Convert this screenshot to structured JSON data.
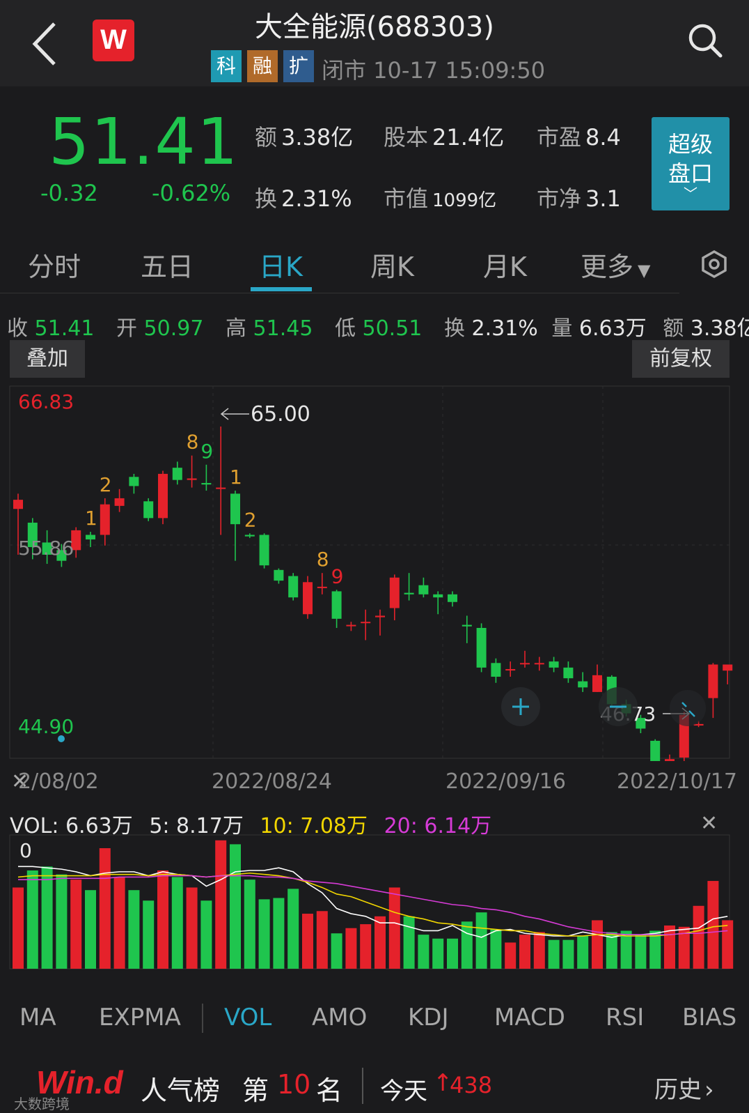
{
  "header": {
    "title": "大全能源(688303)",
    "logo_letter": "W",
    "tags": [
      "科",
      "融",
      "扩"
    ],
    "status": "闭市 10-17 15:09:50"
  },
  "quote": {
    "price": "51.41",
    "change": "-0.32",
    "change_pct": "-0.62%",
    "stats": [
      {
        "label": "额",
        "value": "3.38亿"
      },
      {
        "label": "股本",
        "value": "21.4亿"
      },
      {
        "label": "市盈",
        "value": "8.4"
      },
      {
        "label": "换",
        "value": "2.31%"
      },
      {
        "label": "市值",
        "value": "1099亿"
      },
      {
        "label": "市净",
        "value": "3.1"
      }
    ],
    "super_button": [
      "超级",
      "盘口"
    ]
  },
  "tabs": [
    "分时",
    "五日",
    "日K",
    "周K",
    "月K",
    "更多"
  ],
  "active_tab": "日K",
  "ohlc": {
    "close_label": "收",
    "close": "51.41",
    "open_label": "开",
    "open": "50.97",
    "high_label": "高",
    "high": "51.45",
    "low_label": "低",
    "low": "50.51",
    "turnover_label": "换",
    "turnover": "2.31%",
    "volume_label": "量",
    "volume": "6.63万",
    "amount_label": "额",
    "amount": "3.38亿"
  },
  "buttons": {
    "overlay": "叠加",
    "adjust": "前复权"
  },
  "kline": {
    "axis_top": "66.83",
    "axis_mid": "55.86",
    "axis_bottom": "44.90",
    "max_marker": "65.00",
    "min_marker": "46.73",
    "dates": [
      "2/08/02",
      "2022/08/24",
      "2022/09/16",
      "2022/10/17"
    ]
  },
  "volume": {
    "legend_vol": "VOL: 6.63万",
    "legend_5": "5: 8.17万",
    "legend_10": "10: 7.08万",
    "legend_20": "20: 6.14万",
    "axis_top": "0"
  },
  "indicators": [
    "MA",
    "EXPMA",
    "VOL",
    "AMO",
    "KDJ",
    "MACD",
    "RSI",
    "BIAS"
  ],
  "active_indicator": "VOL",
  "footer": {
    "logo": "Win.d",
    "popularity_label": "人气榜",
    "rank_prefix": "第",
    "rank": "10",
    "rank_suffix": "名",
    "today_label": "今天",
    "today_arrow": "↑",
    "today_value": "438",
    "history": "历史",
    "watermark": "大数跨境"
  },
  "colors": {
    "up": "#e5222b",
    "down": "#1fc54e",
    "accent": "#2aa7c7",
    "ma5": "#ffffff",
    "ma10": "#f2d600",
    "ma20": "#d63bd6"
  },
  "chart_data": {
    "type": "candlestick",
    "ylim": [
      44.9,
      66.83
    ],
    "candles": [
      {
        "o": 59.6,
        "c": 60.2,
        "h": 60.6,
        "l": 56.6
      },
      {
        "o": 58.7,
        "c": 57.1,
        "h": 59.0,
        "l": 56.3
      },
      {
        "o": 57.4,
        "c": 56.6,
        "h": 58.2,
        "l": 56.0
      },
      {
        "o": 56.9,
        "c": 56.2,
        "h": 57.3,
        "l": 55.8
      },
      {
        "o": 56.9,
        "c": 58.2,
        "h": 58.4,
        "l": 56.4
      },
      {
        "o": 57.9,
        "c": 57.6,
        "h": 58.1,
        "l": 57.1
      },
      {
        "o": 57.9,
        "c": 59.9,
        "h": 60.3,
        "l": 57.2
      },
      {
        "o": 59.8,
        "c": 60.3,
        "h": 60.9,
        "l": 59.4
      },
      {
        "o": 61.7,
        "c": 61.1,
        "h": 61.9,
        "l": 60.6
      },
      {
        "o": 60.1,
        "c": 59.0,
        "h": 60.3,
        "l": 58.8
      },
      {
        "o": 59.0,
        "c": 61.9,
        "h": 62.1,
        "l": 58.6
      },
      {
        "o": 62.3,
        "c": 61.5,
        "h": 62.7,
        "l": 61.2
      },
      {
        "o": 61.5,
        "c": 61.6,
        "h": 63.1,
        "l": 61.0
      },
      {
        "o": 61.3,
        "c": 61.2,
        "h": 62.5,
        "l": 60.8
      },
      {
        "o": 61.0,
        "c": 61.0,
        "h": 65.0,
        "l": 57.9
      },
      {
        "o": 60.6,
        "c": 58.6,
        "h": 60.8,
        "l": 56.2
      },
      {
        "o": 57.9,
        "c": 57.8,
        "h": 58.0,
        "l": 57.7
      },
      {
        "o": 57.9,
        "c": 55.9,
        "h": 58.0,
        "l": 55.7
      },
      {
        "o": 55.6,
        "c": 54.9,
        "h": 55.7,
        "l": 54.7
      },
      {
        "o": 55.2,
        "c": 53.8,
        "h": 55.4,
        "l": 53.6
      },
      {
        "o": 52.7,
        "c": 54.8,
        "h": 55.2,
        "l": 52.4
      },
      {
        "o": 54.5,
        "c": 54.5,
        "h": 55.4,
        "l": 54.0
      },
      {
        "o": 54.2,
        "c": 52.4,
        "h": 54.3,
        "l": 51.8
      },
      {
        "o": 52.0,
        "c": 52.0,
        "h": 52.2,
        "l": 51.6
      },
      {
        "o": 52.2,
        "c": 52.2,
        "h": 53.0,
        "l": 51.0
      },
      {
        "o": 52.5,
        "c": 52.6,
        "h": 53.0,
        "l": 51.3
      },
      {
        "o": 53.1,
        "c": 55.1,
        "h": 55.3,
        "l": 52.3
      },
      {
        "o": 54.1,
        "c": 54.0,
        "h": 55.4,
        "l": 53.6
      },
      {
        "o": 54.6,
        "c": 54.0,
        "h": 55.1,
        "l": 53.8
      },
      {
        "o": 54.0,
        "c": 53.8,
        "h": 54.2,
        "l": 52.7
      },
      {
        "o": 54.0,
        "c": 53.5,
        "h": 54.2,
        "l": 53.2
      },
      {
        "o": 52.0,
        "c": 51.9,
        "h": 52.6,
        "l": 50.8
      },
      {
        "o": 51.8,
        "c": 49.2,
        "h": 52.1,
        "l": 48.9
      },
      {
        "o": 49.5,
        "c": 48.6,
        "h": 49.8,
        "l": 48.2
      },
      {
        "o": 49.1,
        "c": 49.1,
        "h": 49.6,
        "l": 48.6
      },
      {
        "o": 49.5,
        "c": 49.5,
        "h": 50.3,
        "l": 49.2
      },
      {
        "o": 49.5,
        "c": 49.5,
        "h": 49.9,
        "l": 49.0
      },
      {
        "o": 49.6,
        "c": 49.2,
        "h": 49.9,
        "l": 48.9
      },
      {
        "o": 49.2,
        "c": 48.5,
        "h": 49.6,
        "l": 48.2
      },
      {
        "o": 48.3,
        "c": 47.9,
        "h": 48.9,
        "l": 47.6
      },
      {
        "o": 47.6,
        "c": 48.7,
        "h": 49.4,
        "l": 47.6
      },
      {
        "o": 48.6,
        "c": 46.8,
        "h": 48.7,
        "l": 46.6
      },
      {
        "o": 46.8,
        "c": 46.2,
        "h": 47.1,
        "l": 46.0
      },
      {
        "o": 45.9,
        "c": 45.2,
        "h": 46.1,
        "l": 44.9
      },
      {
        "o": 44.4,
        "c": 42.7,
        "h": 44.5,
        "l": 42.2
      },
      {
        "o": 42.4,
        "c": 43.2,
        "h": 43.5,
        "l": 41.4
      },
      {
        "o": 43.3,
        "c": 46.1,
        "h": 46.3,
        "l": 41.9
      },
      {
        "o": 45.4,
        "c": 45.5,
        "h": 45.7,
        "l": 45.3
      },
      {
        "o": 47.2,
        "c": 49.4,
        "h": 49.5,
        "l": 45.9
      },
      {
        "o": 49.0,
        "c": 49.4,
        "h": 49.4,
        "l": 48.1
      }
    ],
    "td_labels": [
      {
        "i": 5,
        "text": "1",
        "color": "#e0a030"
      },
      {
        "i": 6,
        "text": "2",
        "color": "#e0a030"
      },
      {
        "i": 12,
        "text": "8",
        "color": "#e0a030"
      },
      {
        "i": 13,
        "text": "9",
        "color": "#1fc54e"
      },
      {
        "i": 15,
        "text": "1",
        "color": "#e0a030"
      },
      {
        "i": 16,
        "text": "2",
        "color": "#e0a030"
      },
      {
        "i": 21,
        "text": "8",
        "color": "#e0a030"
      },
      {
        "i": 22,
        "text": "9",
        "color": "#e5222b"
      }
    ],
    "volumes": [
      0.62,
      0.75,
      0.78,
      0.72,
      0.68,
      0.6,
      0.92,
      0.7,
      0.6,
      0.52,
      0.75,
      0.7,
      0.62,
      0.52,
      0.98,
      0.95,
      0.68,
      0.53,
      0.54,
      0.61,
      0.42,
      0.44,
      0.27,
      0.31,
      0.34,
      0.4,
      0.62,
      0.4,
      0.26,
      0.23,
      0.23,
      0.36,
      0.43,
      0.3,
      0.2,
      0.26,
      0.28,
      0.22,
      0.22,
      0.25,
      0.37,
      0.28,
      0.29,
      0.26,
      0.29,
      0.33,
      0.32,
      0.48,
      0.67,
      0.37
    ],
    "ma5": [
      0.78,
      0.78,
      0.77,
      0.76,
      0.74,
      0.71,
      0.73,
      0.74,
      0.74,
      0.71,
      0.74,
      0.72,
      0.71,
      0.63,
      0.68,
      0.74,
      0.75,
      0.75,
      0.77,
      0.74,
      0.65,
      0.58,
      0.46,
      0.42,
      0.4,
      0.35,
      0.35,
      0.32,
      0.29,
      0.29,
      0.33,
      0.27,
      0.24,
      0.29,
      0.3,
      0.27,
      0.26,
      0.25,
      0.25,
      0.28,
      0.26,
      0.24,
      0.26,
      0.26,
      0.27,
      0.29,
      0.3,
      0.31,
      0.38,
      0.4
    ],
    "ma10": [
      0.7,
      0.71,
      0.71,
      0.71,
      0.71,
      0.71,
      0.72,
      0.72,
      0.72,
      0.71,
      0.72,
      0.72,
      0.71,
      0.7,
      0.71,
      0.72,
      0.73,
      0.72,
      0.71,
      0.69,
      0.66,
      0.62,
      0.57,
      0.55,
      0.51,
      0.47,
      0.43,
      0.4,
      0.38,
      0.35,
      0.34,
      0.32,
      0.31,
      0.3,
      0.29,
      0.29,
      0.27,
      0.26,
      0.25,
      0.25,
      0.26,
      0.26,
      0.25,
      0.25,
      0.25,
      0.26,
      0.27,
      0.29,
      0.32,
      0.33
    ],
    "ma20": [
      0.68,
      0.68,
      0.68,
      0.69,
      0.69,
      0.69,
      0.69,
      0.7,
      0.7,
      0.7,
      0.71,
      0.71,
      0.71,
      0.7,
      0.71,
      0.71,
      0.71,
      0.7,
      0.7,
      0.69,
      0.67,
      0.66,
      0.65,
      0.63,
      0.61,
      0.59,
      0.57,
      0.55,
      0.53,
      0.51,
      0.49,
      0.48,
      0.46,
      0.45,
      0.43,
      0.4,
      0.38,
      0.35,
      0.32,
      0.3,
      0.28,
      0.27,
      0.26,
      0.26,
      0.26,
      0.26,
      0.27,
      0.27,
      0.28,
      0.29
    ]
  }
}
